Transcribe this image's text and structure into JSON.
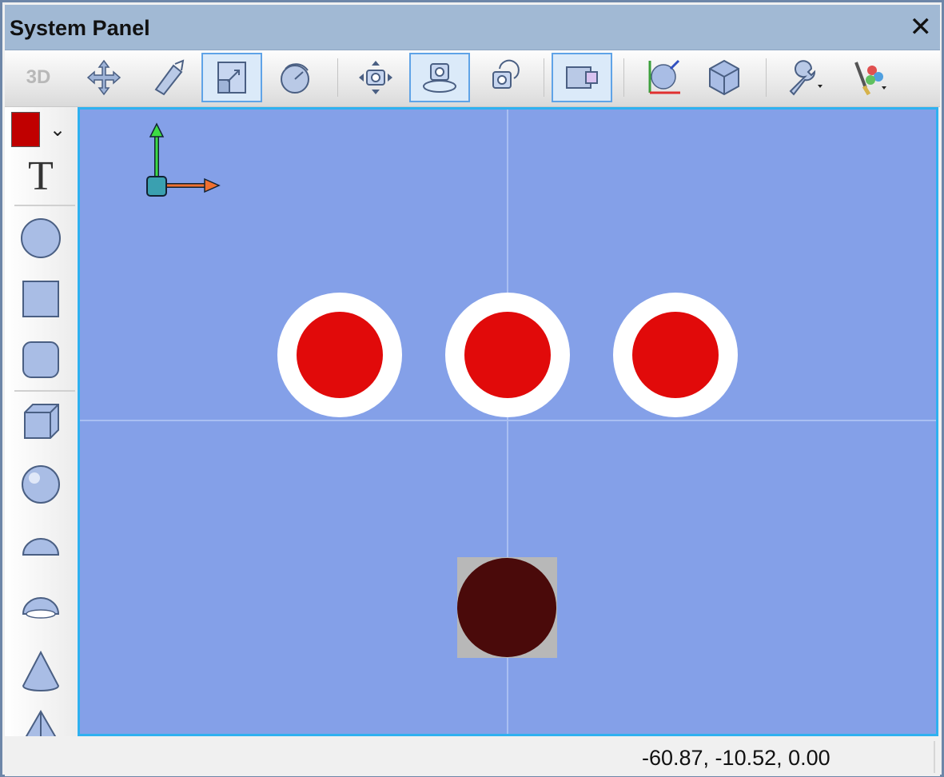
{
  "window": {
    "title": "System Panel",
    "close_symbol": "✕"
  },
  "toolbar": {
    "label_3d": "3D",
    "buttons": [
      {
        "name": "move-icon",
        "selected": false
      },
      {
        "name": "extrude-icon",
        "selected": false
      },
      {
        "name": "scale-icon",
        "selected": true
      },
      {
        "name": "rotate-icon",
        "selected": false
      },
      {
        "name": "pan-camera-icon",
        "selected": false
      },
      {
        "name": "orbit-camera-icon",
        "selected": true
      },
      {
        "name": "rotate-camera-icon",
        "selected": false
      },
      {
        "name": "view-mode-icon",
        "selected": true
      },
      {
        "name": "axes-sphere-icon",
        "selected": false
      },
      {
        "name": "cube-shade-icon",
        "selected": false
      },
      {
        "name": "wrench-icon",
        "selected": false
      },
      {
        "name": "paint-palette-icon",
        "selected": false
      }
    ]
  },
  "sidebar": {
    "color_swatch": "#c00000",
    "text_tool_glyph": "T",
    "tools": [
      "circle-icon",
      "square-icon",
      "rounded-square-icon",
      "cube-icon",
      "sphere-icon",
      "hemisphere-icon",
      "bowl-icon",
      "cone-icon",
      "pyramid-icon"
    ]
  },
  "viewport": {
    "background": "#84a0e8",
    "gizmo": {
      "y_axis_color": "#3ddc44",
      "x_axis_color": "#f07030"
    },
    "objects": [
      {
        "type": "ring-button",
        "fill": "#e10a0a",
        "ring": "#ffffff"
      },
      {
        "type": "ring-button",
        "fill": "#e10a0a",
        "ring": "#ffffff"
      },
      {
        "type": "ring-button",
        "fill": "#e10a0a",
        "ring": "#ffffff"
      },
      {
        "type": "dark-sphere",
        "fill": "#4a0a0a",
        "backdrop": "#b8b8b8"
      }
    ]
  },
  "status": {
    "coordinates": "-60.87, -10.52, 0.00"
  }
}
